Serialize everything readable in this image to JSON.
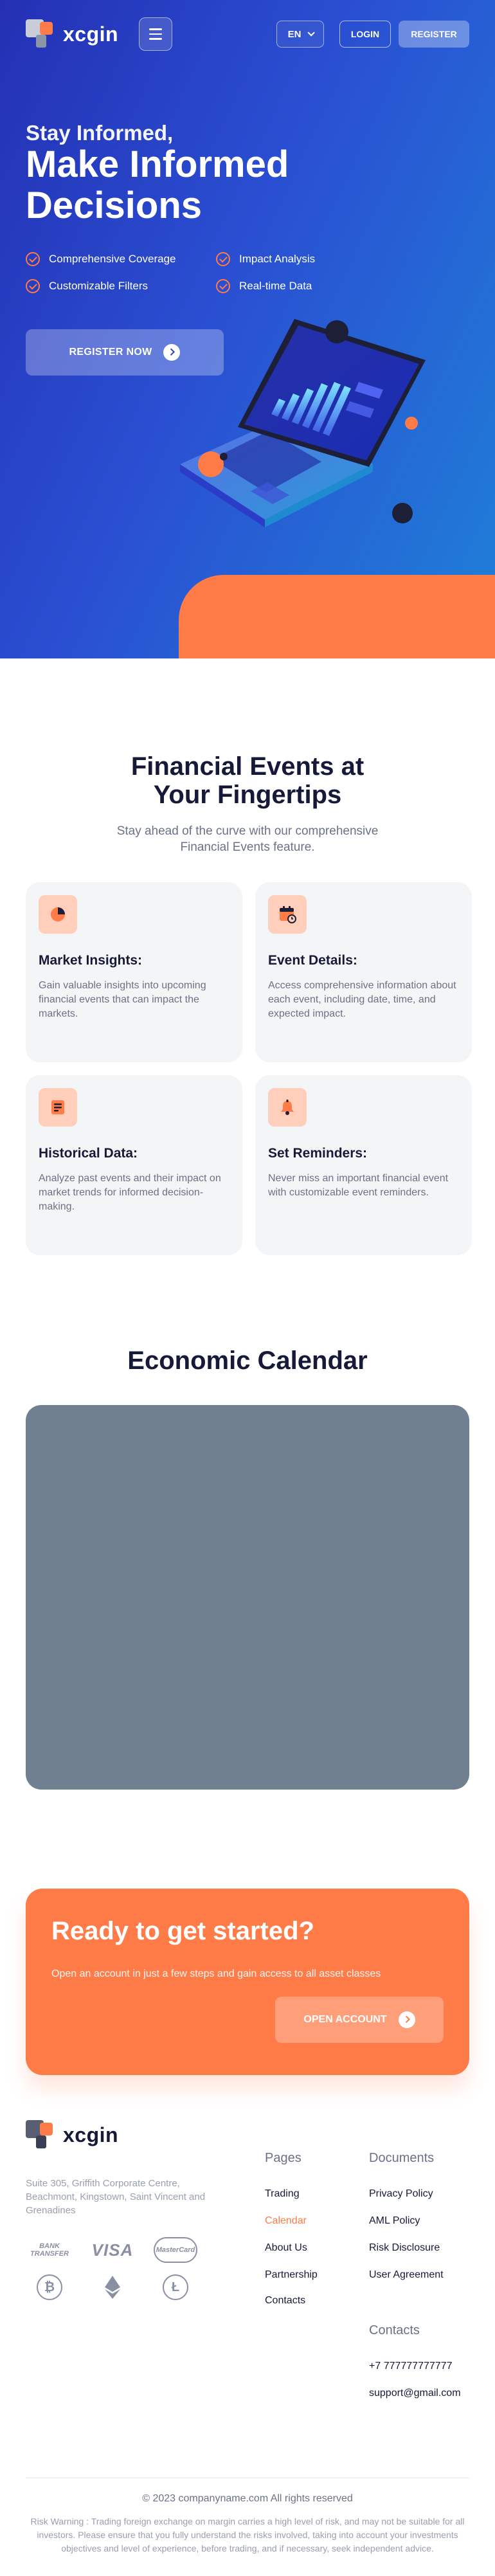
{
  "brand": {
    "name": "xcgin"
  },
  "header": {
    "lang": "EN",
    "login_label": "LOGIN",
    "register_label": "REGISTER"
  },
  "hero": {
    "subtitle": "Stay Informed,",
    "title": "Make Informed Decisions",
    "features": [
      "Comprehensive Coverage",
      "Impact Analysis",
      "Customizable Filters",
      "Real-time Data"
    ],
    "cta_label": "REGISTER NOW"
  },
  "events": {
    "title": "Financial Events at Your Fingertips",
    "description": "Stay ahead of the curve with our comprehensive Financial Events feature.",
    "cards": [
      {
        "icon": "pie-chart-icon",
        "title": "Market Insights:",
        "text": "Gain valuable insights into upcoming financial events that can impact the markets."
      },
      {
        "icon": "calendar-icon",
        "title": "Event Details:",
        "text": "Access comprehensive information about each event, including date, time, and expected impact."
      },
      {
        "icon": "document-icon",
        "title": "Historical Data:",
        "text": "Analyze past events and their impact on market trends for informed decision-making."
      },
      {
        "icon": "bell-icon",
        "title": "Set Reminders:",
        "text": "Never miss an important financial event with customizable event reminders."
      }
    ]
  },
  "calendar": {
    "title": "Economic Calendar"
  },
  "ready": {
    "title": "Ready to get started?",
    "text": "Open an account in just a few steps and gain access to all asset classes",
    "cta_label": "OPEN ACCOUNT"
  },
  "footer": {
    "address": "Suite 305, Griffith Corporate Centre, Beachmont, Kingstown, Saint Vincent and Grenadines",
    "payments": {
      "bank_transfer": [
        "BANK",
        "TRANSFER"
      ],
      "visa": "VISA",
      "mastercard": "MasterCard"
    },
    "pages_title": "Pages",
    "pages": [
      "Trading",
      "Calendar",
      "About Us",
      "Partnership",
      "Contacts"
    ],
    "active_page": "Calendar",
    "documents_title": "Documents",
    "documents": [
      "Privacy Policy",
      "AML Policy",
      "Risk Disclosure",
      "User Agreement"
    ],
    "contacts_title": "Contacts",
    "phone": "+7 777777777777",
    "email": "support@gmail.com",
    "copyright": "© 2023 companyname.com All rights reserved",
    "risk_warning": "Risk Warning : Trading foreign exchange on margin carries a high level of risk, and may not be suitable for all investors. Please ensure that you fully understand the risks involved, taking into account your investments objectives and level of experience, before trading, and if necessary, seek independent advice."
  },
  "colors": {
    "accent": "#ff7b47",
    "hero_start": "#2430b4",
    "hero_end": "#1f80d8",
    "card_bg": "#f4f5f7",
    "calendar_placeholder": "#708090"
  }
}
